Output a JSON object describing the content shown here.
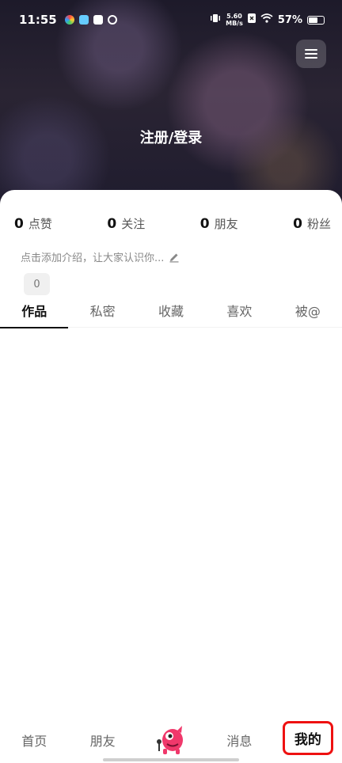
{
  "status_bar": {
    "time": "11:55",
    "net_speed_value": "5.60",
    "net_speed_unit": "MB/s",
    "battery": "57%"
  },
  "header": {
    "register_login": "注册/登录"
  },
  "stats": [
    {
      "count": "0",
      "label": "点赞"
    },
    {
      "count": "0",
      "label": "关注"
    },
    {
      "count": "0",
      "label": "朋友"
    },
    {
      "count": "0",
      "label": "粉丝"
    }
  ],
  "profile": {
    "intro_prompt": "点击添加介绍，让大家认识你...",
    "chip_value": "0"
  },
  "tabs": [
    {
      "label": "作品",
      "active": true
    },
    {
      "label": "私密"
    },
    {
      "label": "收藏"
    },
    {
      "label": "喜欢"
    },
    {
      "label": "被@"
    }
  ],
  "bottom_nav": {
    "home": "首页",
    "friends": "朋友",
    "messages": "消息",
    "me": "我的"
  },
  "colors": {
    "highlight": "#e11111",
    "mascot": "#f0386b"
  }
}
